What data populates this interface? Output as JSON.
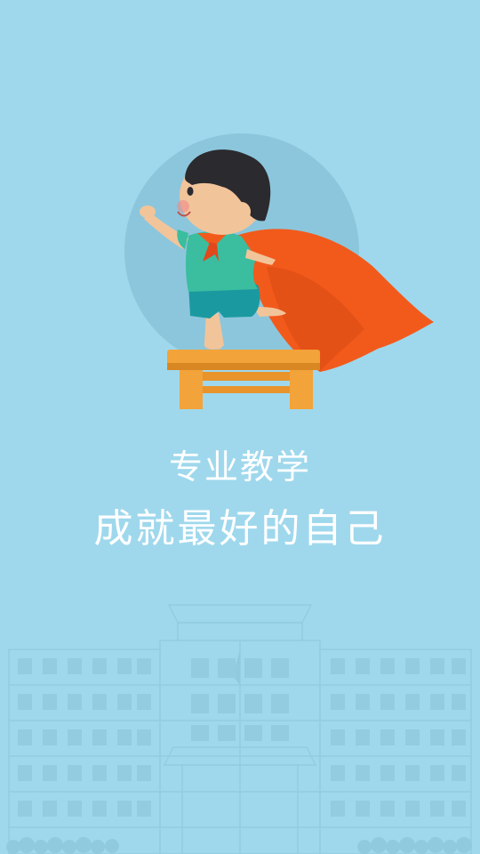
{
  "splash": {
    "slogan_line1": "专业教学",
    "slogan_line2": "成就最好的自己"
  },
  "colors": {
    "background": "#9fd8ec",
    "circle": "#8cc6dc",
    "cape": "#f25a1c",
    "shirt": "#3bbd9f",
    "shorts": "#1a9aa0",
    "stool": "#f2a33a",
    "text": "#ffffff"
  },
  "icons": {
    "hero": "superhero-kid-illustration",
    "background": "school-building-illustration"
  }
}
